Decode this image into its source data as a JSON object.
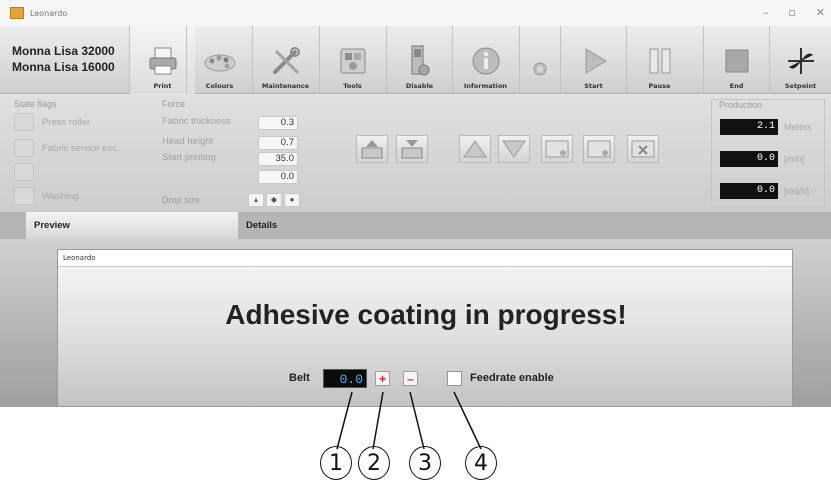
{
  "window": {
    "title": "Leonardo",
    "controls": [
      "–",
      "▫",
      "✕"
    ]
  },
  "machines": [
    "Monna Lisa 32000",
    "Monna Lisa 16000"
  ],
  "toolbar": [
    {
      "label": "Print",
      "icon": "printer-icon"
    },
    {
      "label": "Colours",
      "icon": "colours-icon"
    },
    {
      "label": "Maintenance",
      "icon": "wrench-icon"
    },
    {
      "label": "Tools",
      "icon": "tools-icon"
    },
    {
      "label": "Disable",
      "icon": "disable-icon"
    },
    {
      "label": "Information",
      "icon": "info-icon"
    },
    {
      "label": "",
      "icon": "status-dot-icon"
    },
    {
      "label": "Start",
      "icon": "play-icon"
    },
    {
      "label": "Pause",
      "icon": "pause-icon"
    },
    {
      "label": "End",
      "icon": "stop-icon"
    },
    {
      "label": "Setpoint",
      "icon": "setpoint-icon"
    }
  ],
  "state_flags": {
    "title": "State flags",
    "items": [
      "Press roller",
      "Fabric sensor exc.",
      "",
      "Washing"
    ]
  },
  "force": {
    "title": "Force",
    "rows": [
      {
        "label": "Fabric thickness",
        "value": "0.3"
      },
      {
        "label": "Head height",
        "value": "0.7"
      },
      {
        "label": "Start printing",
        "value": "35.0"
      },
      {
        "label": "",
        "value": "0.0"
      }
    ],
    "drop_size_label": "Drop size"
  },
  "production": {
    "title": "Production",
    "rows": [
      {
        "value": "2.1",
        "unit": "Meters"
      },
      {
        "value": "0.0",
        "unit": "[m/h]"
      },
      {
        "value": "0.0",
        "unit": "[mq/h]"
      }
    ]
  },
  "tabs": {
    "preview": "Preview",
    "details": "Details"
  },
  "dialog": {
    "title": "Leonardo",
    "message": "Adhesive coating in progress!",
    "belt_label": "Belt",
    "belt_value": "0.0",
    "plus_glyph": "+",
    "minus_glyph": "–",
    "feedrate_label": "Feedrate enable"
  },
  "callouts": [
    "1",
    "2",
    "3",
    "4"
  ],
  "colors": {
    "belt_value": "#35b8ff",
    "stepper_glyph": "#d8262f",
    "checkbox_border": "#6d9fd4"
  }
}
